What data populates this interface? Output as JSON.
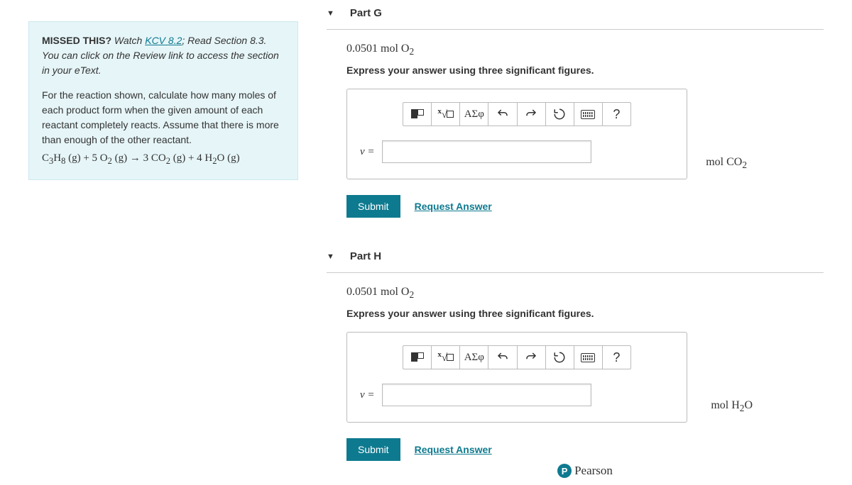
{
  "hint": {
    "missed_label": "MISSED THIS?",
    "watch": "Watch",
    "kcv_link": "KCV 8.2",
    "read": "; Read Section 8.3. You can click on the Review link to access the section in your eText.",
    "description": "For the reaction shown, calculate how many moles of each product form when the given amount of each reactant completely reacts. Assume that there is more than enough of the other reactant.",
    "equation_html": "C<sub>3</sub>H<sub>8</sub> (g) + 5 O<sub>2</sub> (g) → 3 CO<sub>2</sub> (g) + 4 H<sub>2</sub>O (g)"
  },
  "parts": [
    {
      "title": "Part G",
      "amount_html": "0.0501 mol O<sub>2</sub>",
      "instruction": "Express your answer using three significant figures.",
      "var": "ν =",
      "unit_html": "mol CO<sub>2</sub>",
      "submit": "Submit",
      "request": "Request Answer"
    },
    {
      "title": "Part H",
      "amount_html": "0.0501 mol O<sub>2</sub>",
      "instruction": "Express your answer using three significant figures.",
      "var": "ν =",
      "unit_html": "mol H<sub>2</sub>O",
      "submit": "Submit",
      "request": "Request Answer"
    }
  ],
  "toolbar_labels": {
    "greek": "ΑΣφ",
    "help": "?"
  },
  "footer": {
    "brand": "Pearson",
    "p": "P"
  }
}
